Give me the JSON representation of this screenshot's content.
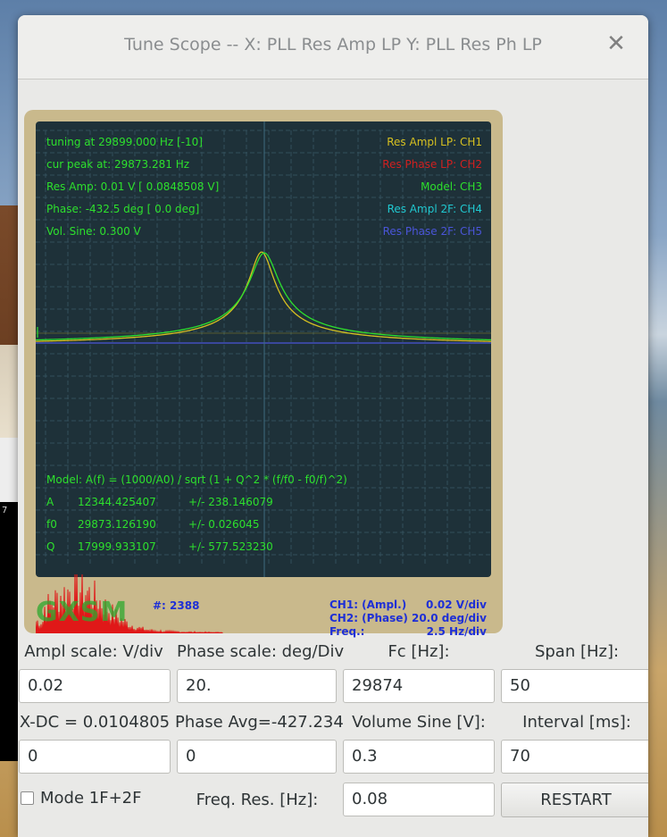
{
  "window": {
    "title": "Tune Scope -- X: PLL Res Amp LP  Y: PLL Res Ph LP",
    "close_icon": "close-icon"
  },
  "background": {
    "dark_label": "7"
  },
  "scope": {
    "info_left": [
      "tuning at 29899.000 Hz [-10]",
      "cur peak at: 29873.281 Hz",
      "Res Amp: 0.01 V [ 0.0848508 V]",
      "Phase: -432.5 deg [ 0.0 deg]",
      "Vol. Sine: 0.300 V"
    ],
    "channels": [
      {
        "name": "Res Ampl LP",
        "ch": "CH1",
        "color": "#d6c020"
      },
      {
        "name": "Res Phase LP",
        "ch": "CH2",
        "color": "#d02020"
      },
      {
        "name": "Model",
        "ch": "CH3",
        "color": "#2de02d"
      },
      {
        "name": "Res Ampl 2F",
        "ch": "CH4",
        "color": "#20c8d0"
      },
      {
        "name": "Res Phase 2F",
        "ch": "CH5",
        "color": "#4a55d8"
      }
    ],
    "model": {
      "formula": "Model:  A(f) = (1000/A0) / sqrt (1 + Q^2 * (f/f0 - f0/f)^2)",
      "rows": [
        {
          "k": "A",
          "v": "12344.425407",
          "pm": "+/- 238.146079"
        },
        {
          "k": "f0",
          "v": "29873.126190",
          "pm": "+/-   0.026045"
        },
        {
          "k": "Q",
          "v": "17999.933107",
          "pm": "+/- 577.523230"
        }
      ]
    },
    "logo": "GXSM",
    "count": "#: 2388",
    "scale_info": [
      {
        "left": "CH1: (Ampl.)",
        "right": "0.02 V/div"
      },
      {
        "left": "CH2: (Phase)",
        "right": "20.0 deg/div"
      },
      {
        "left": "Freq.:",
        "right": "2.5 Hz/div"
      }
    ]
  },
  "controls": {
    "ampl_scale": {
      "label": "Ampl scale: V/div",
      "value": "0.02"
    },
    "phase_scale": {
      "label": "Phase scale: deg/Div",
      "value": "20."
    },
    "fc": {
      "label": "Fc [Hz]:",
      "value": "29874"
    },
    "span": {
      "label": "Span [Hz]:",
      "value": "50"
    },
    "xdc": {
      "label": "X-DC = 0.0104805",
      "value": "0"
    },
    "phase_avg": {
      "label": "Phase Avg=-427.234",
      "value": "0"
    },
    "volume_sine": {
      "label": "Volume Sine [V]:",
      "value": "0.3"
    },
    "interval": {
      "label": "Interval [ms]:",
      "value": "70"
    },
    "mode": {
      "label": "Mode 1F+2F",
      "checked": false
    },
    "freq_res": {
      "label": "Freq. Res. [Hz]:",
      "value": "0.08"
    },
    "restart_label": "RESTART"
  }
}
